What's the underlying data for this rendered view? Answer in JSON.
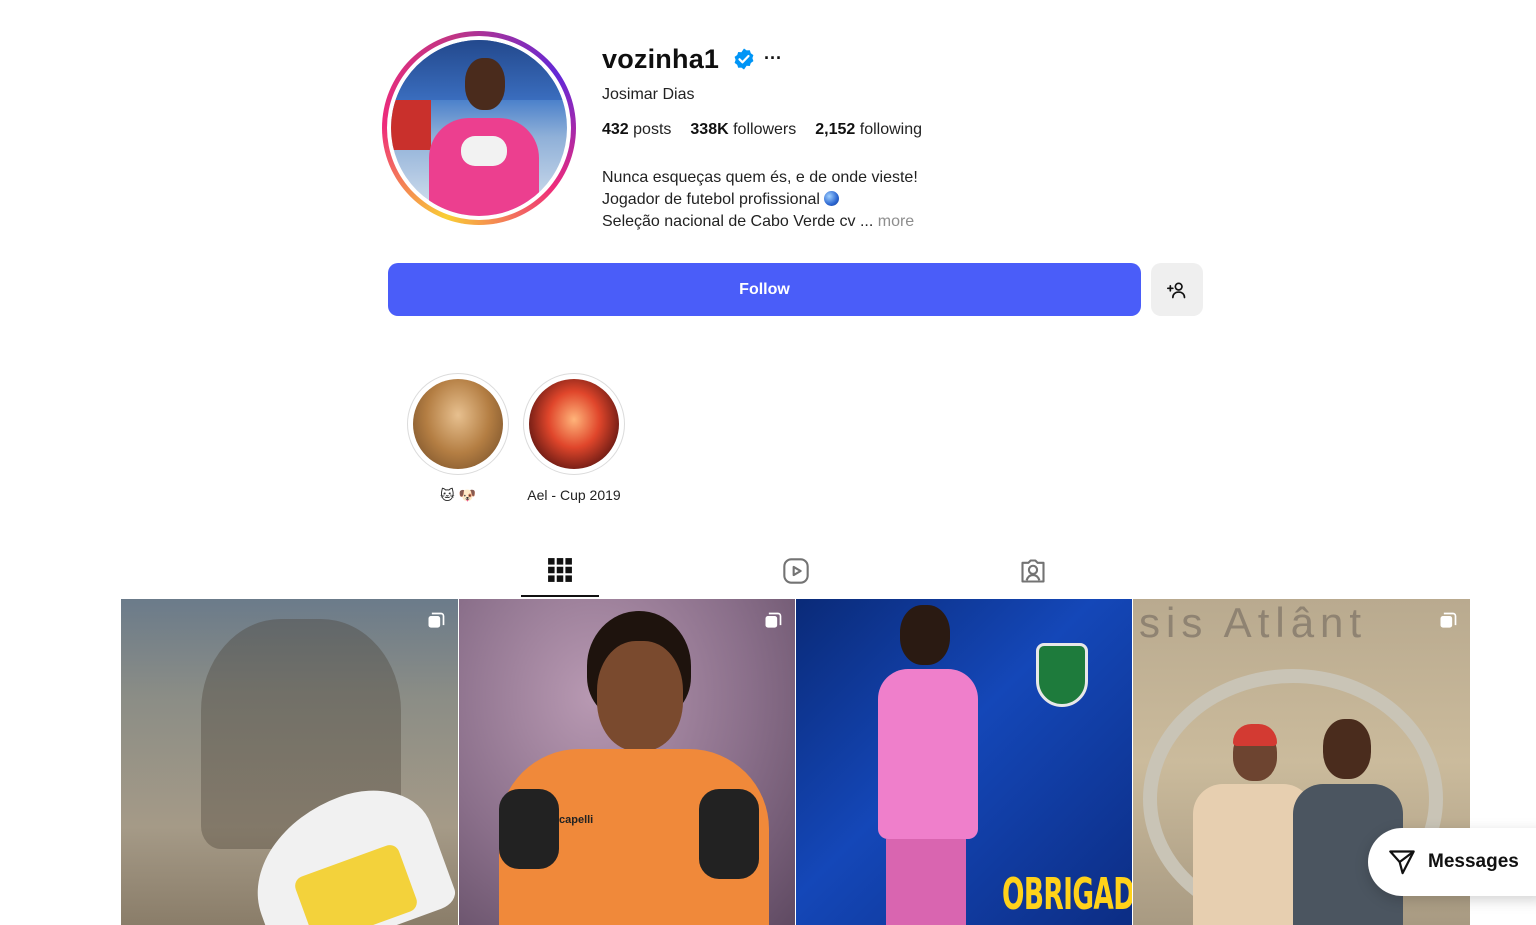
{
  "profile": {
    "username": "vozinha1",
    "full_name": "Josimar Dias",
    "stats": {
      "posts_count": "432",
      "posts_label": "posts",
      "followers_count": "338K",
      "followers_label": "followers",
      "following_count": "2,152",
      "following_label": "following"
    },
    "bio": {
      "line1": "Nunca esqueças quem és, e de onde vieste!",
      "line2": "Jogador de futebol profissional",
      "line3": "Seleção nacional de Cabo Verde cv ...",
      "more": "more"
    },
    "more_options": "···"
  },
  "actions": {
    "follow_label": "Follow"
  },
  "highlights": [
    {
      "label": "🐱 🐶"
    },
    {
      "label": "Ael - Cup 2019"
    }
  ],
  "tabs": [
    {
      "icon": "grid-icon",
      "active": true
    },
    {
      "icon": "reels-icon",
      "active": false
    },
    {
      "icon": "tagged-icon",
      "active": false
    }
  ],
  "posts": [
    {
      "multi": true
    },
    {
      "multi": true,
      "caption_text": "capelli"
    },
    {
      "multi": false,
      "caption_text": "OBRIGADO!"
    },
    {
      "multi": true,
      "caption_text": "sis Atlânt"
    }
  ],
  "messages": {
    "label": "Messages"
  },
  "colors": {
    "primary": "#4a5df9",
    "verified": "#0095f6"
  }
}
